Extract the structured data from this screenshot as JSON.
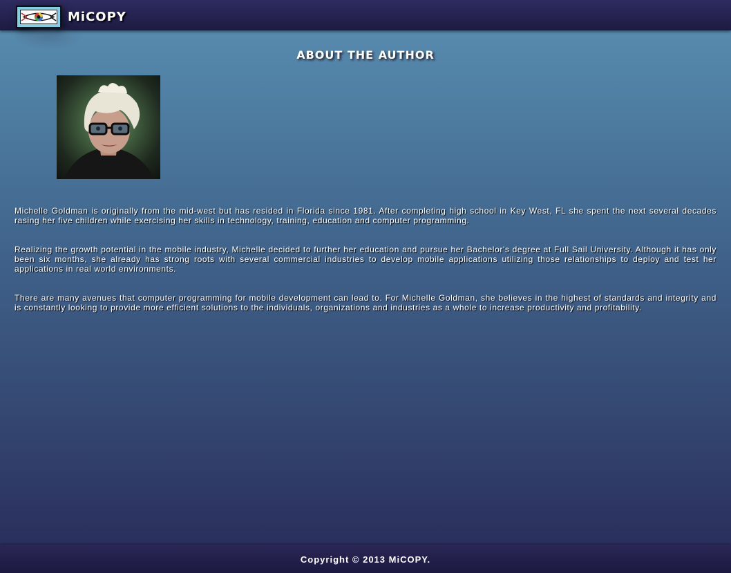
{
  "header": {
    "brand": "MiCOPY",
    "logo_icon": "eye-logo-icon"
  },
  "main": {
    "title": "ABOUT THE AUTHOR",
    "photo_icon": "author-photo",
    "paragraphs": [
      "Michelle Goldman is originally from the mid-west but has resided in Florida since 1981. After completing high school in Key West, FL she spent the next several decades rasing her five children while exercising her skills in technology, training, education and computer programming.",
      "Realizing the growth potential in the mobile industry, Michelle decided to further her education and pursue her Bachelor's degree at Full Sail University. Although it has only been six months, she already has strong roots with several commercial industries to develop mobile applications utilizing those relationships to deploy and test her applications in real world environments.",
      "There are many avenues that computer programming for mobile development can lead to. For Michelle Goldman, she believes in the highest of standards and integrity and is constantly looking to provide more efficient solutions to the individuals, organizations and industries as a whole to increase productivity and profitability."
    ]
  },
  "footer": {
    "copyright": "Copyright © 2013 MiCOPY."
  },
  "colors": {
    "header_bg": "#1d1a42",
    "page_top": "#5a8fb2",
    "page_bottom": "#2a2f5c",
    "logo_frame": "#7fd0e6",
    "text": "#ffffff"
  }
}
